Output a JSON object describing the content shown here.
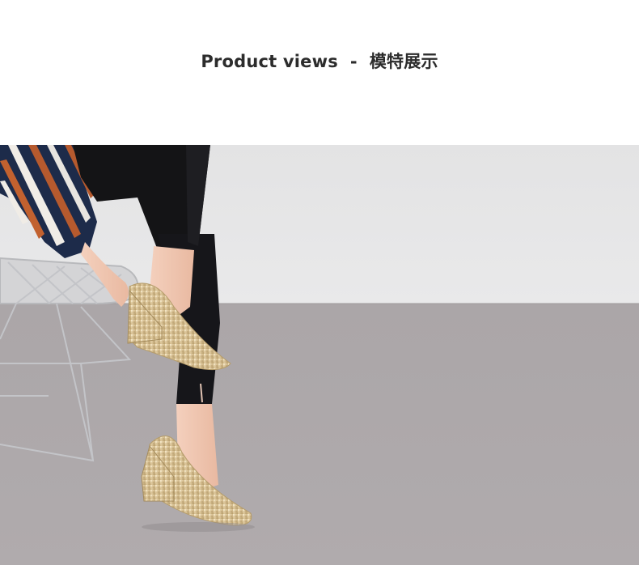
{
  "section": {
    "title": "Product views  -  模特展示"
  },
  "photo": {
    "subject": "model-seated-wearing-gold-glitter-wedge-pumps",
    "colors": {
      "wall": "#e6e6e7",
      "floor": "#aca7a9",
      "trousers": "#141416",
      "skin": "#f2c7b2",
      "shoe_gold": "#d9c39a",
      "chair_wire": "#bfc0c4"
    }
  }
}
